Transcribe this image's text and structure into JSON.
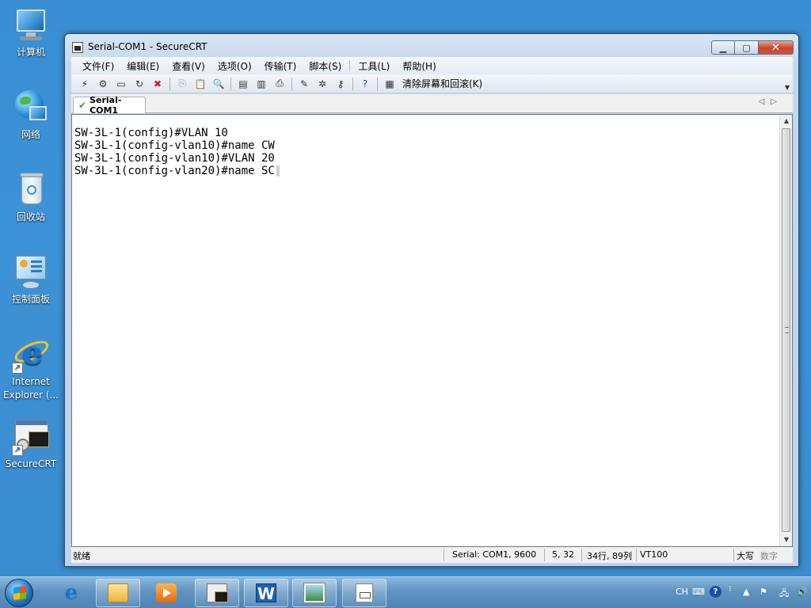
{
  "desktop": {
    "icons": [
      {
        "label": "计算机"
      },
      {
        "label": "网络"
      },
      {
        "label": "回收站"
      },
      {
        "label": "控制面板"
      },
      {
        "label": "Internet Explorer (..."
      },
      {
        "label": "SecureCRT"
      }
    ]
  },
  "window": {
    "title": "Serial-COM1 - SecureCRT",
    "menu": [
      "文件(F)",
      "编辑(E)",
      "查看(V)",
      "选项(O)",
      "传输(T)",
      "脚本(S)",
      "工具(L)",
      "帮助(H)"
    ],
    "toolbar": {
      "clear_label": "清除屏幕和回滚(K)"
    },
    "tab": {
      "label": "Serial-COM1",
      "status": "connected"
    },
    "terminal": {
      "lines": [
        "SW-3L-1(config)#VLAN 10",
        "SW-3L-1(config-vlan10)#name CW",
        "SW-3L-1(config-vlan10)#VLAN 20",
        "SW-3L-1(config-vlan20)#name SC"
      ]
    },
    "status": {
      "ready": "就绪",
      "connection": "Serial: COM1, 9600",
      "cursor": "5, 32",
      "size": "34行, 89列",
      "emulation": "VT100",
      "caps": "大写",
      "num": "数字"
    }
  },
  "taskbar": {
    "tray": {
      "lang": "CH"
    }
  },
  "colors": {
    "desktop": "#3a8fd4",
    "close_button": "#c8442c",
    "tab_check": "#35a03a"
  }
}
